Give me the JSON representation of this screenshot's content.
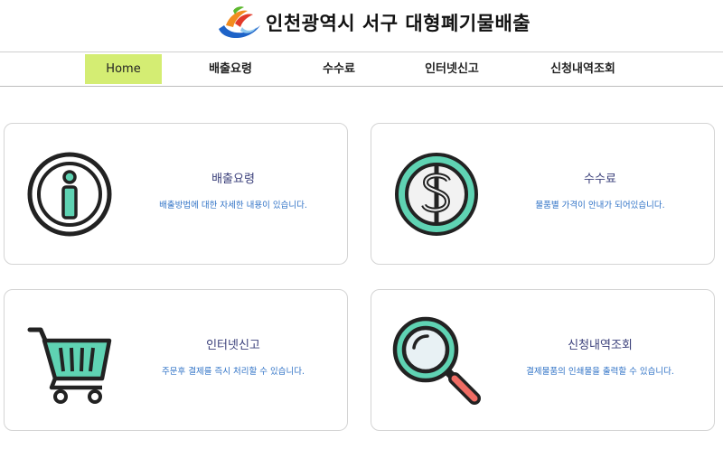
{
  "header": {
    "title": "인천광역시 서구  대형폐기물배출"
  },
  "nav": [
    {
      "label": "Home",
      "active": true
    },
    {
      "label": "배출요령"
    },
    {
      "label": "수수료"
    },
    {
      "label": "인터넷신고"
    },
    {
      "label": "신청내역조회"
    }
  ],
  "cards": [
    {
      "title": "배출요령",
      "desc": "배출방법에 대한 자세한 내용이 있습니다.",
      "icon": "info-icon"
    },
    {
      "title": "수수료",
      "desc": "물품별 가격이 안내가 되어있습니다.",
      "icon": "dollar-coin-icon"
    },
    {
      "title": "인터넷신고",
      "desc": "주문후 결제를 즉시 처리할 수 있습니다.",
      "icon": "shopping-cart-icon"
    },
    {
      "title": "신청내역조회",
      "desc": "결제물품의 인쇄물을 출력할 수 있습니다.",
      "icon": "magnifier-icon"
    }
  ],
  "colors": {
    "nav_active_bg": "#d4ed73",
    "accent_teal": "#5fd3b3",
    "title_color": "#3a3f7a",
    "desc_color": "#2f72c6"
  }
}
